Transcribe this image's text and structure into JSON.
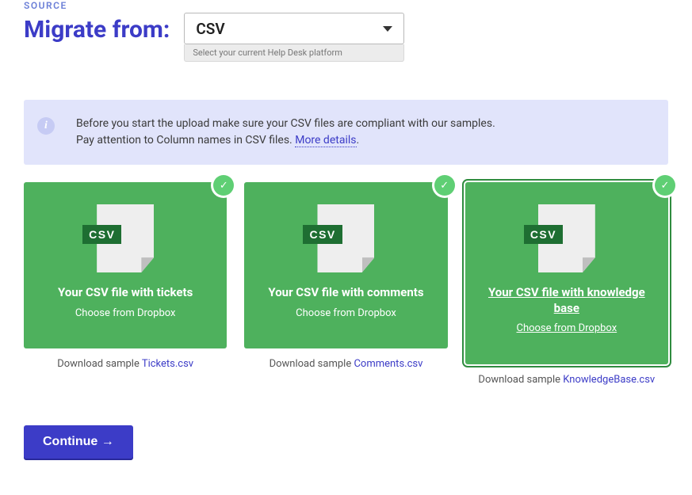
{
  "header": {
    "source_label": "SOURCE",
    "migrate_title": "Migrate from:",
    "select_value": "CSV",
    "select_hint": "Select your current Help Desk platform"
  },
  "info": {
    "line1": "Before you start the upload make sure your CSV files are compliant with our samples.",
    "line2_prefix": "Pay attention to Column names in CSV files. ",
    "more_details": "More details",
    "line2_suffix": "."
  },
  "cards": [
    {
      "icon_label": "CSV",
      "title": "Your CSV file with tickets",
      "sub": "Choose from Dropbox",
      "download_prefix": "Download sample ",
      "download_link": "Tickets.csv",
      "active": false
    },
    {
      "icon_label": "CSV",
      "title": "Your CSV file with comments",
      "sub": "Choose from Dropbox",
      "download_prefix": "Download sample ",
      "download_link": "Comments.csv",
      "active": false
    },
    {
      "icon_label": "CSV",
      "title": "Your CSV file with knowledge base",
      "sub": "Choose from Dropbox",
      "download_prefix": "Download sample ",
      "download_link": "KnowledgeBase.csv",
      "active": true
    }
  ],
  "actions": {
    "continue": "Continue →"
  }
}
